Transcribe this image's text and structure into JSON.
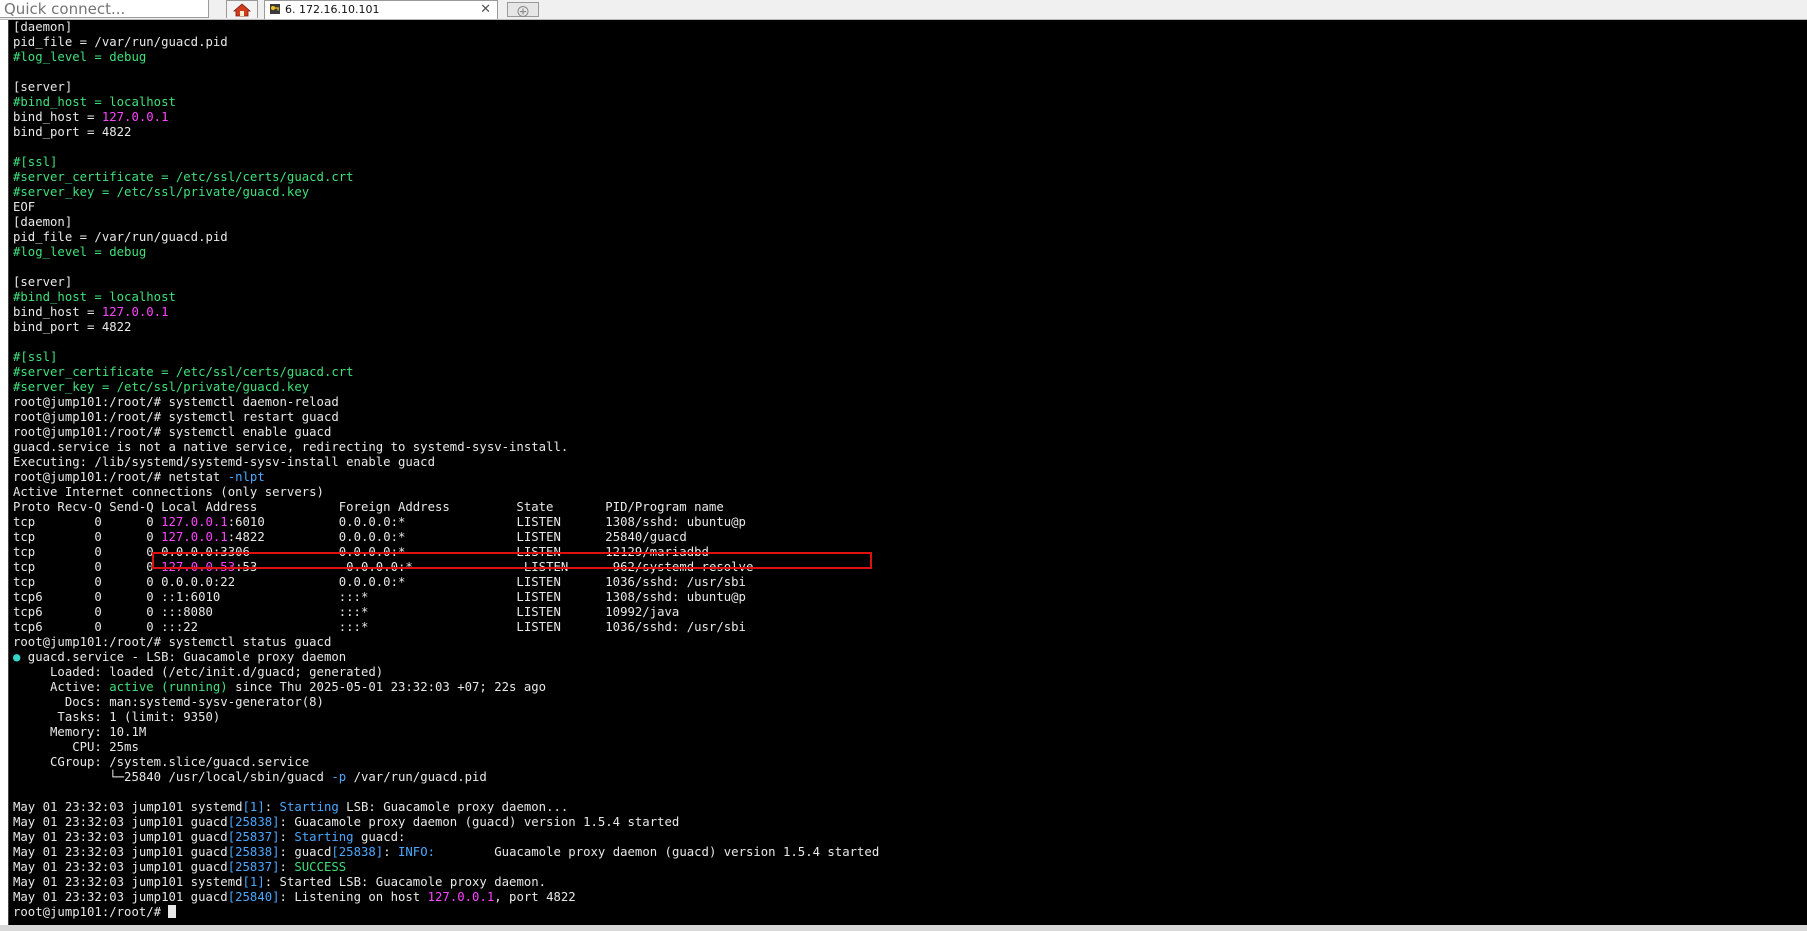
{
  "toolbar": {
    "quick_connect_placeholder": "Quick connect...",
    "home_icon": "home-icon",
    "tab_icon": "key-icon",
    "tab_title": "6. 172.16.10.101",
    "tab_close": "✕",
    "new_tab_icon": "plus-icon"
  },
  "colors": {
    "terminal_bg": "#000000",
    "default_text": "#e8e8e8",
    "comment": "#3fe07a",
    "ip": "#ff44ff",
    "keyword": "#4aa8ff",
    "status_dot": "#33d6c8",
    "highlight_border": "#e01010"
  },
  "terminal": {
    "lines": [
      [
        {
          "t": "[daemon]"
        }
      ],
      [
        {
          "t": "pid_file = /var/run/guacd.pid"
        }
      ],
      [
        {
          "t": "#log_level = debug",
          "c": "green"
        }
      ],
      [
        {
          "t": ""
        }
      ],
      [
        {
          "t": "[server]"
        }
      ],
      [
        {
          "t": "#bind_host = localhost",
          "c": "green"
        }
      ],
      [
        {
          "t": "bind_host = "
        },
        {
          "t": "127.0.0.1",
          "c": "magenta"
        }
      ],
      [
        {
          "t": "bind_port = 4822"
        }
      ],
      [
        {
          "t": ""
        }
      ],
      [
        {
          "t": "#[ssl]",
          "c": "green"
        }
      ],
      [
        {
          "t": "#server_certificate = /etc/ssl/certs/guacd.crt",
          "c": "green"
        }
      ],
      [
        {
          "t": "#server_key = /etc/ssl/private/guacd.key",
          "c": "green"
        }
      ],
      [
        {
          "t": "EOF"
        }
      ],
      [
        {
          "t": "[daemon]"
        }
      ],
      [
        {
          "t": "pid_file = /var/run/guacd.pid"
        }
      ],
      [
        {
          "t": "#log_level = debug",
          "c": "green"
        }
      ],
      [
        {
          "t": ""
        }
      ],
      [
        {
          "t": "[server]"
        }
      ],
      [
        {
          "t": "#bind_host = localhost",
          "c": "green"
        }
      ],
      [
        {
          "t": "bind_host = "
        },
        {
          "t": "127.0.0.1",
          "c": "magenta"
        }
      ],
      [
        {
          "t": "bind_port = 4822"
        }
      ],
      [
        {
          "t": ""
        }
      ],
      [
        {
          "t": "#[ssl]",
          "c": "green"
        }
      ],
      [
        {
          "t": "#server_certificate = /etc/ssl/certs/guacd.crt",
          "c": "green"
        }
      ],
      [
        {
          "t": "#server_key = /etc/ssl/private/guacd.key",
          "c": "green"
        }
      ],
      [
        {
          "t": "root@jump101:/root/# systemctl daemon-reload"
        }
      ],
      [
        {
          "t": "root@jump101:/root/# systemctl restart guacd"
        }
      ],
      [
        {
          "t": "root@jump101:/root/# systemctl enable guacd"
        }
      ],
      [
        {
          "t": "guacd.service is not a native service, redirecting to systemd-sysv-install."
        }
      ],
      [
        {
          "t": "Executing: /lib/systemd/systemd-sysv-install enable guacd"
        }
      ],
      [
        {
          "t": "root@jump101:/root/# netstat "
        },
        {
          "t": "-nlpt",
          "c": "blue"
        }
      ],
      [
        {
          "t": "Active Internet connections (only servers)"
        }
      ],
      [
        {
          "t": "Proto Recv-Q Send-Q Local Address           Foreign Address         State       PID/Program name"
        }
      ],
      [
        {
          "t": "tcp        0      0 "
        },
        {
          "t": "127.0.0.1",
          "c": "magenta"
        },
        {
          "t": ":6010          0.0.0.0:*               LISTEN      1308/sshd: ubuntu@p"
        }
      ],
      [
        {
          "t": "tcp        0      0 "
        },
        {
          "t": "127.0.0.1",
          "c": "magenta"
        },
        {
          "t": ":4822          0.0.0.0:*               LISTEN      25840/guacd"
        }
      ],
      [
        {
          "t": "tcp        0      0 0.0.0.0:3306            0.0.0.0:*               LISTEN      12129/mariadbd"
        }
      ],
      [
        {
          "t": "tcp        0      0 "
        },
        {
          "t": "127.0.0.53",
          "c": "magenta"
        },
        {
          "t": ":53            0.0.0.0:*               LISTEN      962/systemd-resolve"
        }
      ],
      [
        {
          "t": "tcp        0      0 0.0.0.0:22              0.0.0.0:*               LISTEN      1036/sshd: /usr/sbi"
        }
      ],
      [
        {
          "t": "tcp6       0      0 ::1:6010                :::*                    LISTEN      1308/sshd: ubuntu@p"
        }
      ],
      [
        {
          "t": "tcp6       0      0 :::8080                 :::*                    LISTEN      10992/java"
        }
      ],
      [
        {
          "t": "tcp6       0      0 :::22                   :::*                    LISTEN      1036/sshd: /usr/sbi"
        }
      ],
      [
        {
          "t": "root@jump101:/root/# systemctl status guacd"
        }
      ],
      [
        {
          "t": "●",
          "c": "cyan"
        },
        {
          "t": " guacd.service - LSB: Guacamole proxy daemon"
        }
      ],
      [
        {
          "t": "     Loaded: loaded (/etc/init.d/guacd; generated)"
        }
      ],
      [
        {
          "t": "     Active: "
        },
        {
          "t": "active (running)",
          "c": "green"
        },
        {
          "t": " since Thu 2025-05-01 23:32:03 +07; 22s ago"
        }
      ],
      [
        {
          "t": "       Docs: man:systemd-sysv-generator(8)"
        }
      ],
      [
        {
          "t": "      Tasks: 1 (limit: 9350)"
        }
      ],
      [
        {
          "t": "     Memory: 10.1M"
        }
      ],
      [
        {
          "t": "        CPU: 25ms"
        }
      ],
      [
        {
          "t": "     CGroup: /system.slice/guacd.service"
        }
      ],
      [
        {
          "t": "             └─25840 /usr/local/sbin/guacd "
        },
        {
          "t": "-p",
          "c": "blue"
        },
        {
          "t": " /var/run/guacd.pid"
        }
      ],
      [
        {
          "t": ""
        }
      ],
      [
        {
          "t": "May 01 23:32:03 jump101 systemd"
        },
        {
          "t": "[1]",
          "c": "blue"
        },
        {
          "t": ": "
        },
        {
          "t": "Starting",
          "c": "blue"
        },
        {
          "t": " LSB: Guacamole proxy daemon..."
        }
      ],
      [
        {
          "t": "May 01 23:32:03 jump101 guacd"
        },
        {
          "t": "[25838]",
          "c": "blue"
        },
        {
          "t": ": Guacamole proxy daemon (guacd) version 1.5.4 started"
        }
      ],
      [
        {
          "t": "May 01 23:32:03 jump101 guacd"
        },
        {
          "t": "[25837]",
          "c": "blue"
        },
        {
          "t": ": "
        },
        {
          "t": "Starting",
          "c": "blue"
        },
        {
          "t": " guacd:"
        }
      ],
      [
        {
          "t": "May 01 23:32:03 jump101 guacd"
        },
        {
          "t": "[25838]",
          "c": "blue"
        },
        {
          "t": ": guacd"
        },
        {
          "t": "[25838]",
          "c": "blue"
        },
        {
          "t": ": "
        },
        {
          "t": "INFO:",
          "c": "blue"
        },
        {
          "t": "        Guacamole proxy daemon (guacd) version 1.5.4 started"
        }
      ],
      [
        {
          "t": "May 01 23:32:03 jump101 guacd"
        },
        {
          "t": "[25837]",
          "c": "blue"
        },
        {
          "t": ": "
        },
        {
          "t": "SUCCESS",
          "c": "green"
        }
      ],
      [
        {
          "t": "May 01 23:32:03 jump101 systemd"
        },
        {
          "t": "[1]",
          "c": "blue"
        },
        {
          "t": ": Started LSB: Guacamole proxy daemon."
        }
      ],
      [
        {
          "t": "May 01 23:32:03 jump101 guacd"
        },
        {
          "t": "[25840]",
          "c": "blue"
        },
        {
          "t": ": Listening on host "
        },
        {
          "t": "127.0.0.1",
          "c": "magenta"
        },
        {
          "t": ", port 4822"
        }
      ],
      [
        {
          "t": "root@jump101:/root/# "
        }
      ]
    ]
  }
}
